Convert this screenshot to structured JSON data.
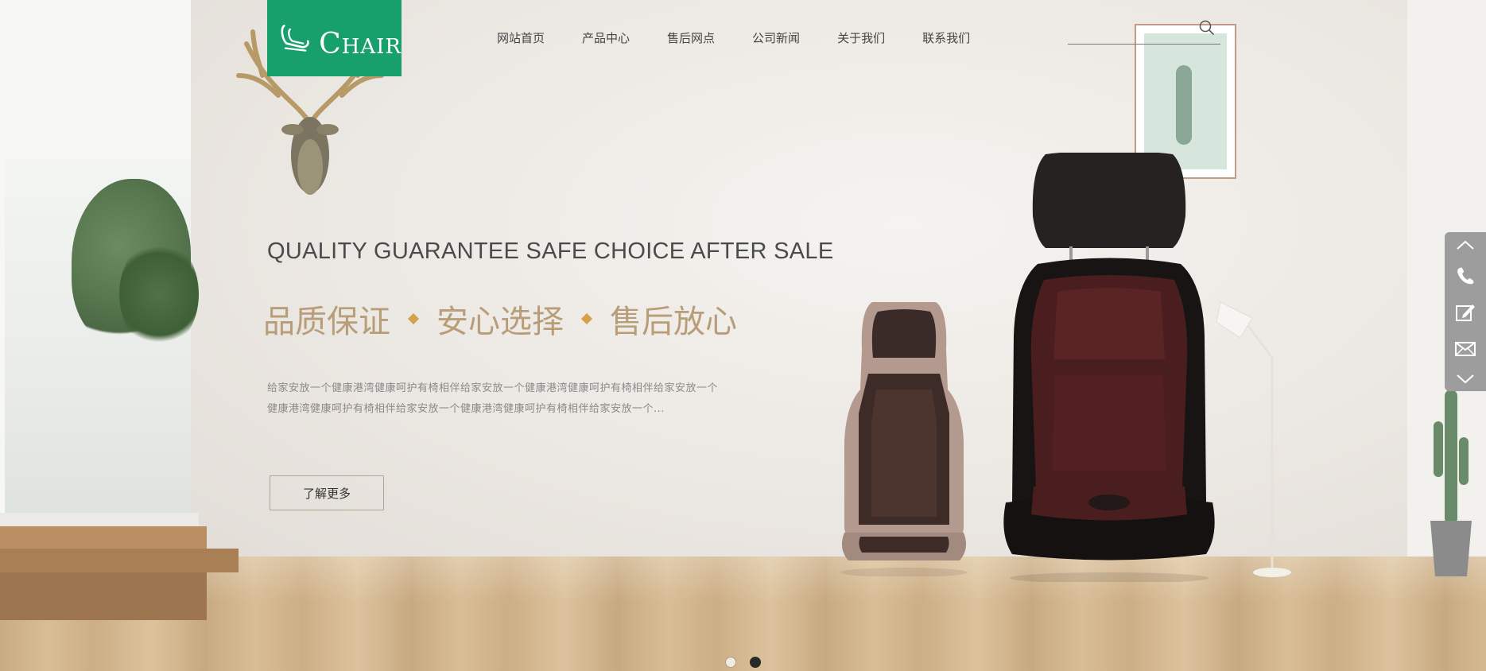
{
  "brand": {
    "logo_text": "HAIR",
    "logo_initial": "C",
    "accent_color": "#17a06b"
  },
  "nav": {
    "items": [
      {
        "label": "网站首页"
      },
      {
        "label": "产品中心"
      },
      {
        "label": "售后网点"
      },
      {
        "label": "公司新闻"
      },
      {
        "label": "关于我们"
      },
      {
        "label": "联系我们"
      }
    ]
  },
  "search": {
    "placeholder": "",
    "icon": "search-icon"
  },
  "hero": {
    "title_en": "QUALITY GUARANTEE SAFE CHOICE AFTER SALE",
    "title_cn": [
      "品质保证",
      "安心选择",
      "售后放心"
    ],
    "description": "给家安放一个健康港湾健康呵护有椅相伴给家安放一个健康港湾健康呵护有椅相伴给家安放一个健康港湾健康呵护有椅相伴给家安放一个健康港湾健康呵护有椅相伴给家安放一个...",
    "button_label": "了解更多",
    "title_cn_color": "#b89d79",
    "separator_color": "#d4a14d"
  },
  "sidebar": {
    "items": [
      {
        "icon": "chevron-up-icon"
      },
      {
        "icon": "phone-icon"
      },
      {
        "icon": "edit-icon"
      },
      {
        "icon": "mail-icon"
      },
      {
        "icon": "chevron-down-icon"
      }
    ]
  },
  "slider": {
    "slides": 2,
    "active_index": 1
  }
}
